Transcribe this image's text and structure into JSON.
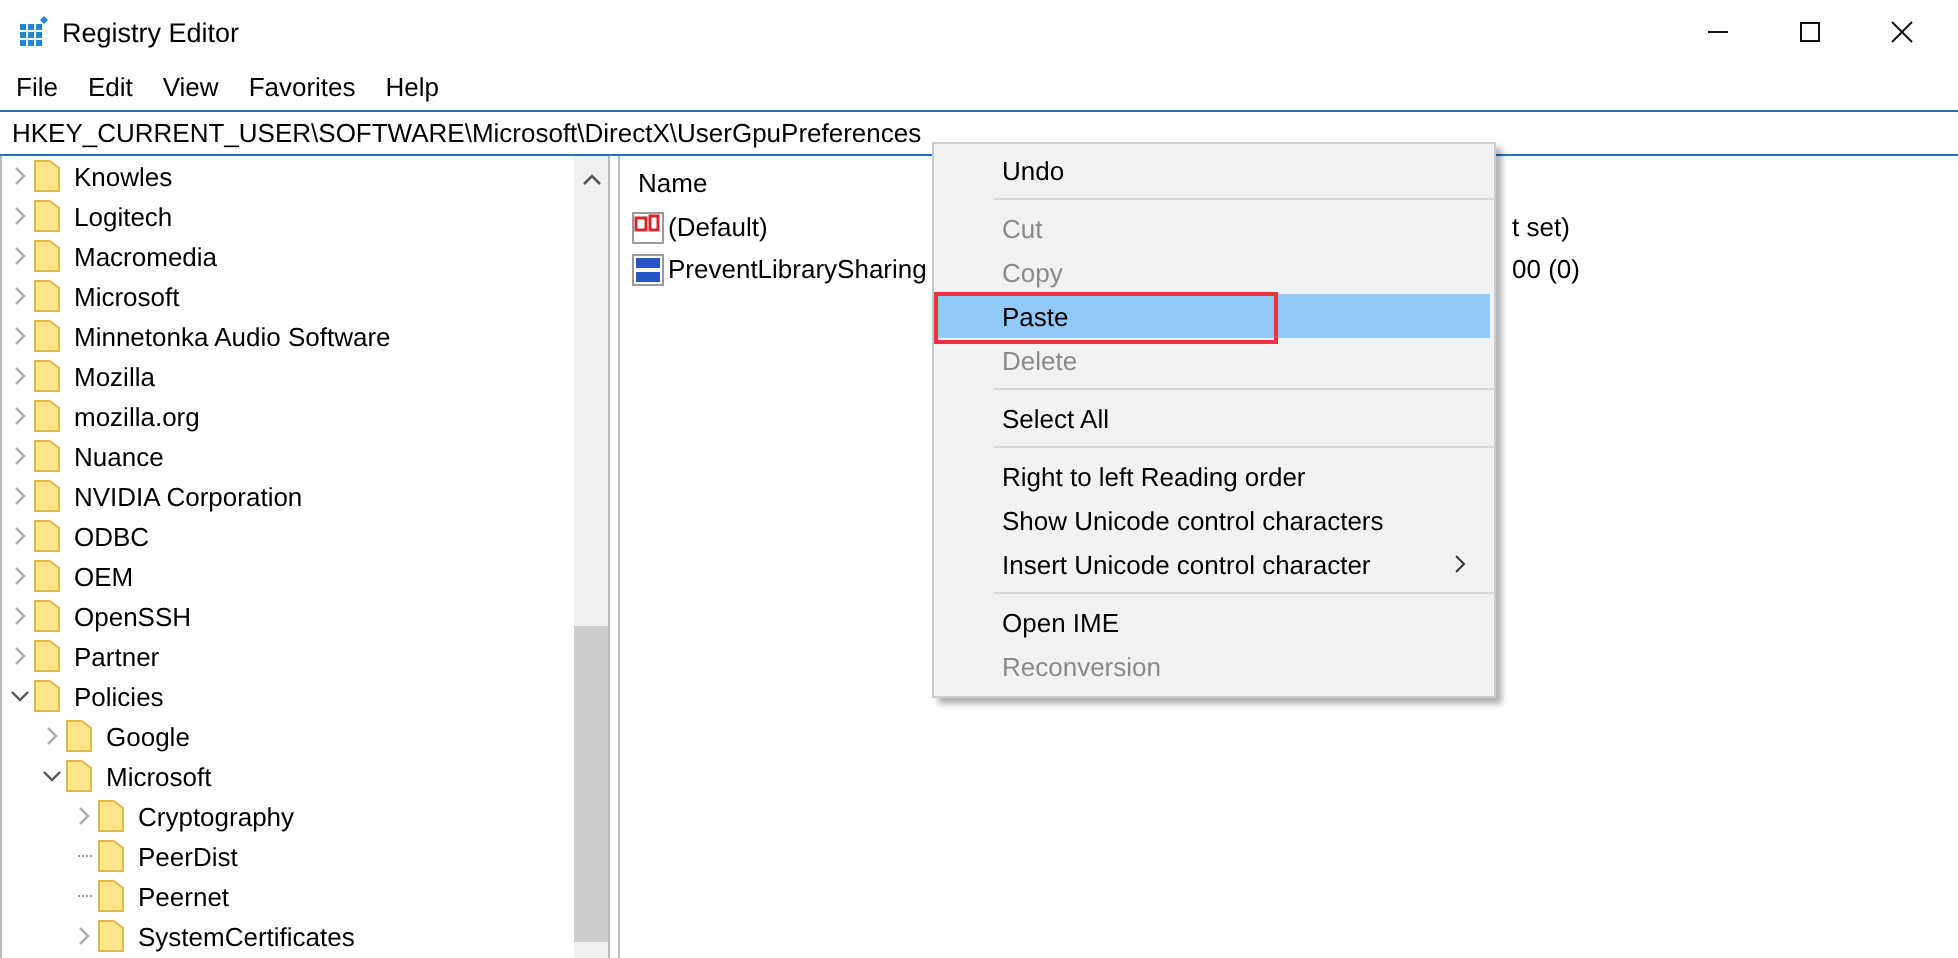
{
  "window": {
    "title": "Registry Editor"
  },
  "menu_bar": [
    "File",
    "Edit",
    "View",
    "Favorites",
    "Help"
  ],
  "address": "HKEY_CURRENT_USER\\SOFTWARE\\Microsoft\\DirectX\\UserGpuPreferences",
  "tree": [
    {
      "label": "Knowles",
      "kind": "node",
      "expanded": false
    },
    {
      "label": "Logitech",
      "kind": "node",
      "expanded": false
    },
    {
      "label": "Macromedia",
      "kind": "node",
      "expanded": false
    },
    {
      "label": "Microsoft",
      "kind": "node",
      "expanded": false
    },
    {
      "label": "Minnetonka Audio Software",
      "kind": "node",
      "expanded": false
    },
    {
      "label": "Mozilla",
      "kind": "node",
      "expanded": false
    },
    {
      "label": "mozilla.org",
      "kind": "node",
      "expanded": false
    },
    {
      "label": "Nuance",
      "kind": "node",
      "expanded": false
    },
    {
      "label": "NVIDIA Corporation",
      "kind": "node",
      "expanded": false
    },
    {
      "label": "ODBC",
      "kind": "node",
      "expanded": false
    },
    {
      "label": "OEM",
      "kind": "node",
      "expanded": false
    },
    {
      "label": "OpenSSH",
      "kind": "node",
      "expanded": false
    },
    {
      "label": "Partner",
      "kind": "node",
      "expanded": false
    },
    {
      "label": "Policies",
      "kind": "node",
      "expanded": true,
      "children": [
        {
          "label": "Google",
          "kind": "node",
          "expanded": false
        },
        {
          "label": "Microsoft",
          "kind": "node",
          "expanded": true,
          "children": [
            {
              "label": "Cryptography",
              "kind": "node",
              "expanded": false
            },
            {
              "label": "PeerDist",
              "kind": "leaf"
            },
            {
              "label": "Peernet",
              "kind": "leaf"
            },
            {
              "label": "SystemCertificates",
              "kind": "node",
              "expanded": false
            }
          ]
        }
      ]
    }
  ],
  "values": {
    "columns": [
      "Name"
    ],
    "rows": [
      {
        "kind": "string",
        "name": "(Default)",
        "data": "t set)"
      },
      {
        "kind": "dword",
        "name": "PreventLibrarySharing",
        "data": "00 (0)"
      }
    ]
  },
  "context_menu": [
    {
      "kind": "item",
      "label": "Undo",
      "disabled": false,
      "selected": false,
      "annotated": false,
      "submenu": false
    },
    {
      "kind": "separator"
    },
    {
      "kind": "item",
      "label": "Cut",
      "disabled": true,
      "selected": false,
      "annotated": false,
      "submenu": false
    },
    {
      "kind": "item",
      "label": "Copy",
      "disabled": true,
      "selected": false,
      "annotated": false,
      "submenu": false
    },
    {
      "kind": "item",
      "label": "Paste",
      "disabled": false,
      "selected": true,
      "annotated": true,
      "submenu": false
    },
    {
      "kind": "item",
      "label": "Delete",
      "disabled": true,
      "selected": false,
      "annotated": false,
      "submenu": false
    },
    {
      "kind": "separator"
    },
    {
      "kind": "item",
      "label": "Select All",
      "disabled": false,
      "selected": false,
      "annotated": false,
      "submenu": false
    },
    {
      "kind": "separator"
    },
    {
      "kind": "item",
      "label": "Right to left Reading order",
      "disabled": false,
      "selected": false,
      "annotated": false,
      "submenu": false
    },
    {
      "kind": "item",
      "label": "Show Unicode control characters",
      "disabled": false,
      "selected": false,
      "annotated": false,
      "submenu": false
    },
    {
      "kind": "item",
      "label": "Insert Unicode control character",
      "disabled": false,
      "selected": false,
      "annotated": false,
      "submenu": true
    },
    {
      "kind": "separator"
    },
    {
      "kind": "item",
      "label": "Open IME",
      "disabled": false,
      "selected": false,
      "annotated": false,
      "submenu": false
    },
    {
      "kind": "item",
      "label": "Reconversion",
      "disabled": true,
      "selected": false,
      "annotated": false,
      "submenu": false
    }
  ]
}
